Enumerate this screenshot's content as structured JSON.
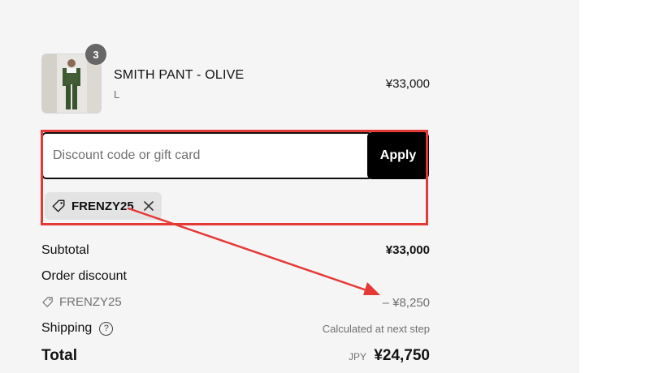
{
  "product": {
    "name": "SMITH PANT - OLIVE",
    "variant": "L",
    "price": "¥33,000",
    "quantity": "3",
    "image_icon": "product-photo"
  },
  "discount": {
    "placeholder": "Discount code or gift card",
    "apply_label": "Apply",
    "applied_code": "FRENZY25"
  },
  "summary": {
    "subtotal_label": "Subtotal",
    "subtotal_value": "¥33,000",
    "order_discount_label": "Order discount",
    "discount_code": "FRENZY25",
    "discount_value": "– ¥8,250",
    "shipping_label": "Shipping",
    "shipping_value": "Calculated at next step",
    "total_label": "Total",
    "total_currency": "JPY",
    "total_value": "¥24,750"
  },
  "colors": {
    "annotation": "#e53935",
    "apply_bg": "#000000",
    "panel_bg": "#f5f5f5"
  }
}
